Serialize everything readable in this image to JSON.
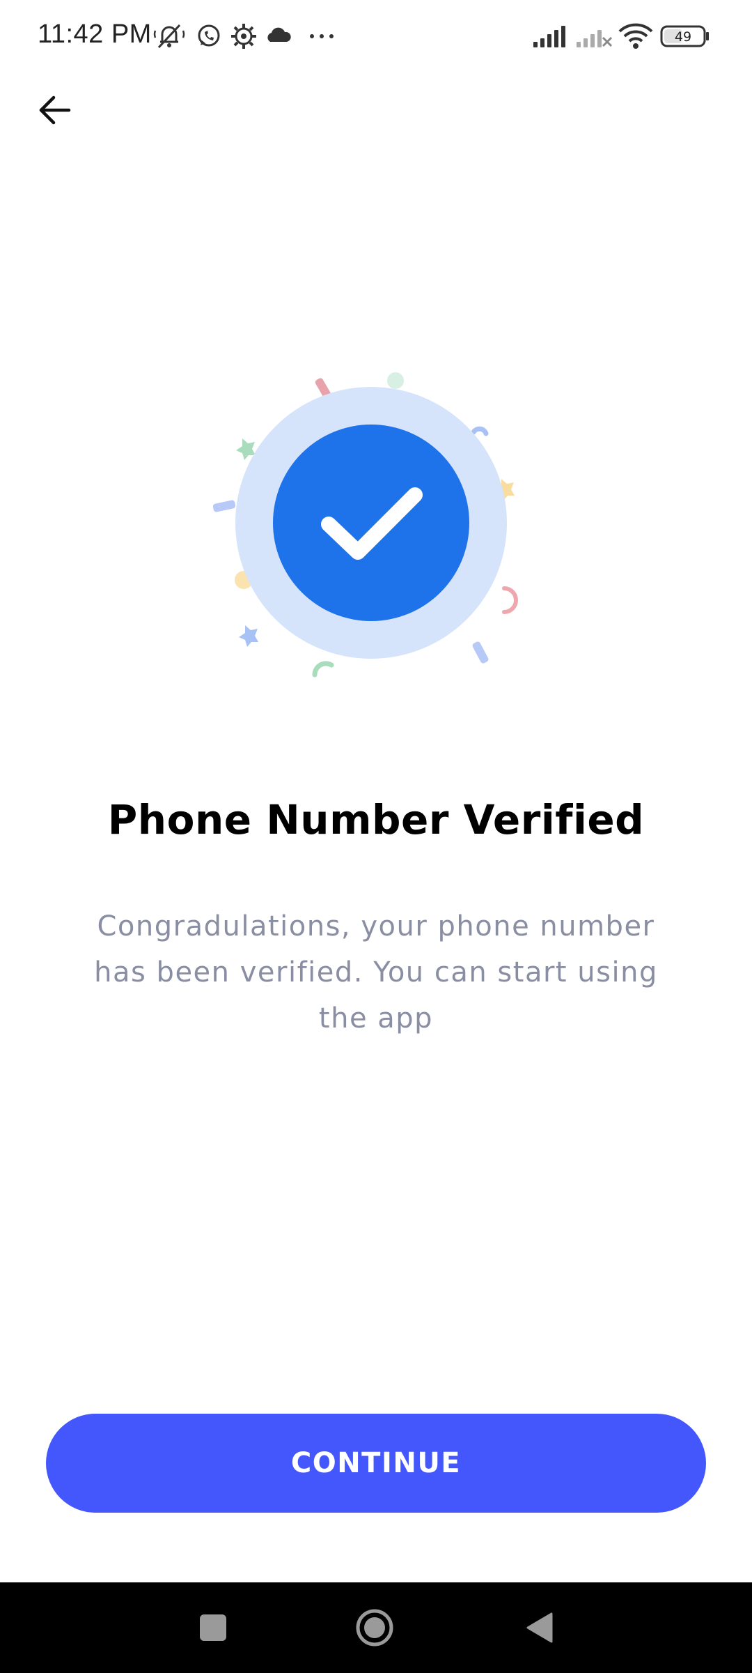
{
  "status_bar": {
    "time": "11:42 PM",
    "battery_level": "49",
    "icons": [
      "mute-notifications-icon",
      "whatsapp-icon",
      "settings-gear-icon",
      "cloud-icon",
      "more-dots-icon",
      "signal-icon",
      "signal-no-service-icon",
      "wifi-icon",
      "battery-icon"
    ]
  },
  "header": {
    "back_icon": "arrow-left-icon"
  },
  "illustration": {
    "icon": "checkmark-icon",
    "colors": {
      "outer_ring": "#d6e4fb",
      "inner_circle": "#1f73ea",
      "check": "#ffffff"
    }
  },
  "content": {
    "title": "Phone Number Verified",
    "subtitle": "Congradulations, your phone number has been verified. You can start using the app"
  },
  "actions": {
    "continue_label": "CONTINUE",
    "accent_color": "#4457fc"
  },
  "nav_bar": {
    "items": [
      "recents-square-icon",
      "home-circle-icon",
      "back-triangle-icon"
    ]
  }
}
